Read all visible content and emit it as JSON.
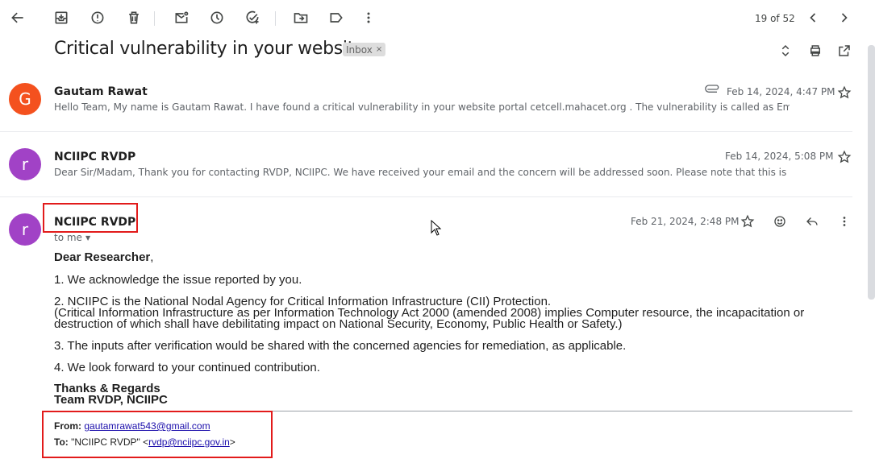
{
  "toolbar": {
    "pager": "19 of 52",
    "icons": [
      "back-arrow-icon",
      "archive-icon",
      "report-spam-icon",
      "delete-icon",
      "mark-unread-icon",
      "snooze-icon",
      "add-task-icon",
      "move-to-icon",
      "label-icon",
      "more-vert-icon",
      "prev-icon",
      "next-icon"
    ]
  },
  "thread": {
    "subject": "Critical vulnerability in your website",
    "label": "Inbox",
    "label_remove": "×"
  },
  "messages": [
    {
      "avatar_letter": "G",
      "avatar_color": "#f4511e",
      "sender": "Gautam Rawat",
      "snippet": "Hello Team, My name is Gautam Rawat. I have found a critical vulnerability in your website portal cetcell.mahacet.org . The vulnerability is called as Email spo",
      "date": "Feb 14, 2024, 4:47 PM",
      "has_attachment": true
    },
    {
      "avatar_letter": "r",
      "avatar_color": "#a142c6",
      "sender": "NCIIPC RVDP",
      "snippet": "Dear Sir/Madam, Thank you for contacting RVDP, NCIIPC. We have received your email and the concern will be addressed soon. Please note that this is an auto-gene",
      "date": "Feb 14, 2024, 5:08 PM"
    },
    {
      "avatar_letter": "r",
      "avatar_color": "#a142c6",
      "sender": "NCIIPC RVDP",
      "recipient": "to me",
      "date": "Feb 21, 2024, 2:48 PM",
      "body": {
        "greeting": "Dear Researcher",
        "greeting_punct": ",",
        "p1": "1. We acknowledge the issue reported by you.",
        "p2_l1": "2. NCIIPC is the National Nodal Agency for Critical Information Infrastructure (CII) Protection.",
        "p2_l2": "(Critical Information Infrastructure as per Information Technology Act 2000 (amended 2008) implies Computer resource, the incapacitation or",
        "p2_l3": "destruction of which shall have debilitating impact on National Security, Economy, Public Health or Safety.)",
        "p3": "3. The inputs after verification would be shared with the concerned agencies for remediation, as applicable.",
        "p4": "4. We look forward to your continued contribution.",
        "sig1": "Thanks & Regards",
        "sig2": "Team RVDP, NCIIPC"
      },
      "footer": {
        "from_label": "From:",
        "from_email": "gautamrawat543@gmail.com",
        "to_label": "To:",
        "to_name": "\"NCIIPC RVDP\" <",
        "to_email": "rvdp@nciipc.gov.in",
        "to_close": ">"
      }
    }
  ],
  "colors": {
    "highlight": "#e21b1b",
    "link": "#1a0dab"
  }
}
